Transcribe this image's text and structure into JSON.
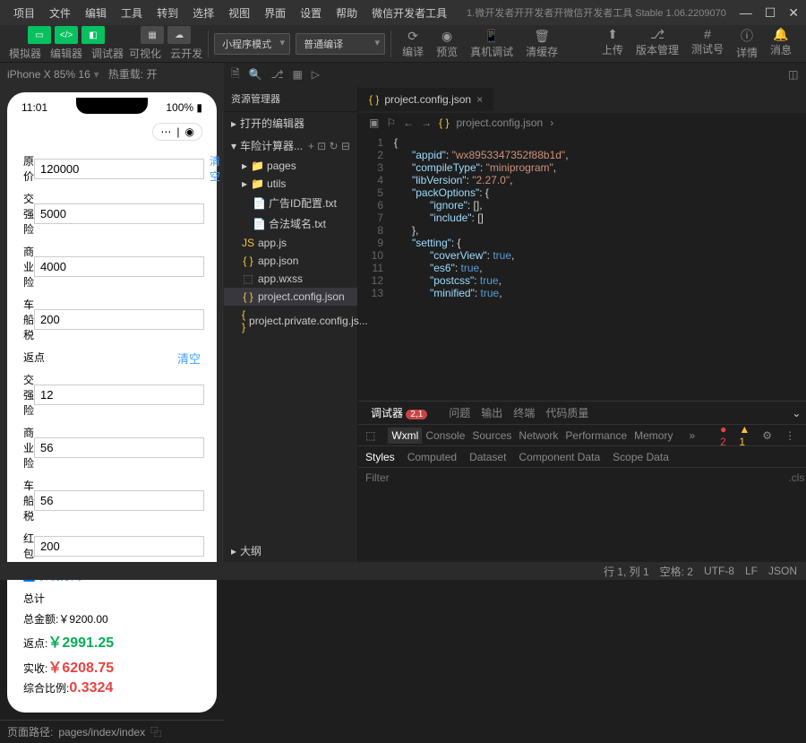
{
  "menubar": [
    "项目",
    "文件",
    "编辑",
    "工具",
    "转到",
    "选择",
    "视图",
    "界面",
    "设置",
    "帮助",
    "微信开发者工具"
  ],
  "titlebar": {
    "title": "1.微开发者开开发者开微信开发者工具 Stable 1.06.2209070"
  },
  "toolbar": {
    "group1_labels": [
      "模拟器",
      "编辑器",
      "调试器"
    ],
    "viz": "可视化",
    "cloud": "云开发",
    "mode": "小程序模式",
    "compile": "普通编译",
    "actions": [
      {
        "l": "编译"
      },
      {
        "l": "预览"
      },
      {
        "l": "真机调试"
      },
      {
        "l": "清缓存"
      }
    ],
    "right": [
      {
        "l": "上传"
      },
      {
        "l": "版本管理"
      },
      {
        "l": "测试号"
      },
      {
        "l": "详情"
      },
      {
        "l": "消息"
      }
    ]
  },
  "sim": {
    "device": "iPhone X 85% 16",
    "hot": "热重载: 开",
    "time": "11:01",
    "battery": "100%",
    "form": {
      "yuan_lbl": "原价",
      "yuan_val": "120000",
      "clear": "清空",
      "jq_lbl": "交强险",
      "jq_val": "5000",
      "sy_lbl": "商业险",
      "sy_val": "4000",
      "cc_lbl": "车船税",
      "cc_val": "200",
      "fd_title": "返点",
      "fd_jq_lbl": "交强险",
      "fd_jq_val": "12",
      "fd_sy_lbl": "商业险",
      "fd_sy_val": "56",
      "fd_cc_lbl": "车船税",
      "fd_cc_val": "56",
      "hb_lbl": "红 包",
      "hb_val": "200",
      "tax_sep": "价税分离",
      "total_title": "总计",
      "total_amt_lbl": "总金额:",
      "total_amt": "￥9200.00",
      "fd_lbl": "返点:",
      "fd_amt": "￥2991.25",
      "ss_lbl": "实收:",
      "ss_amt": "￥6208.75",
      "ratio_lbl": "综合比例:",
      "ratio": "0.3324"
    },
    "footer": {
      "path_lbl": "页面路径:",
      "path": "pages/index/index"
    }
  },
  "explorer": {
    "title": "资源管理器",
    "sect1": "打开的编辑器",
    "proj": "车险计算器...",
    "items": [
      {
        "l": "pages",
        "t": "folder"
      },
      {
        "l": "utils",
        "t": "folder"
      },
      {
        "l": "广告ID配置.txt",
        "t": "txt",
        "sub": true
      },
      {
        "l": "合法域名.txt",
        "t": "txt",
        "sub": true
      },
      {
        "l": "app.js",
        "t": "js"
      },
      {
        "l": "app.json",
        "t": "json"
      },
      {
        "l": "app.wxss",
        "t": "wxss"
      },
      {
        "l": "project.config.json",
        "t": "json",
        "sel": true
      },
      {
        "l": "project.private.config.js...",
        "t": "json"
      }
    ],
    "outline": "大纲"
  },
  "editor": {
    "tab": "project.config.json",
    "crumb": "project.config.json",
    "lines": [
      {
        "n": 1,
        "t": "{"
      },
      {
        "n": 2,
        "k": "appid",
        "v": "wx8953347352f88b1d",
        "c": ","
      },
      {
        "n": 3,
        "k": "compileType",
        "v": "miniprogram",
        "c": ","
      },
      {
        "n": 4,
        "k": "libVersion",
        "v": "2.27.0",
        "c": ","
      },
      {
        "n": 5,
        "k": "packOptions",
        "obj": "{"
      },
      {
        "n": 6,
        "k": "ignore",
        "arr": "[],"
      },
      {
        "n": 7,
        "k": "include",
        "arr": "[]"
      },
      {
        "n": 8,
        "t": "},"
      },
      {
        "n": 9,
        "k": "setting",
        "obj": "{"
      },
      {
        "n": 10,
        "k": "coverView",
        "b": "true",
        "c": ","
      },
      {
        "n": 11,
        "k": "es6",
        "b": "true",
        "c": ","
      },
      {
        "n": 12,
        "k": "postcss",
        "b": "true",
        "c": ","
      },
      {
        "n": 13,
        "k": "minified",
        "b": "true",
        "c": ","
      }
    ]
  },
  "debug": {
    "title": "调试器",
    "badge": "2,1",
    "tabs": [
      "问题",
      "输出",
      "终端",
      "代码质量"
    ],
    "tools": [
      "Wxml",
      "Console",
      "Sources",
      "Network",
      "Performance",
      "Memory"
    ],
    "err": "2",
    "warn": "1",
    "styletabs": [
      "Styles",
      "Computed",
      "Dataset",
      "Component Data",
      "Scope Data"
    ],
    "filter": "Filter",
    "cls": ".cls"
  },
  "status": {
    "pos": "行 1, 列 1",
    "spaces": "空格: 2",
    "enc": "UTF-8",
    "eol": "LF",
    "lang": "JSON"
  }
}
